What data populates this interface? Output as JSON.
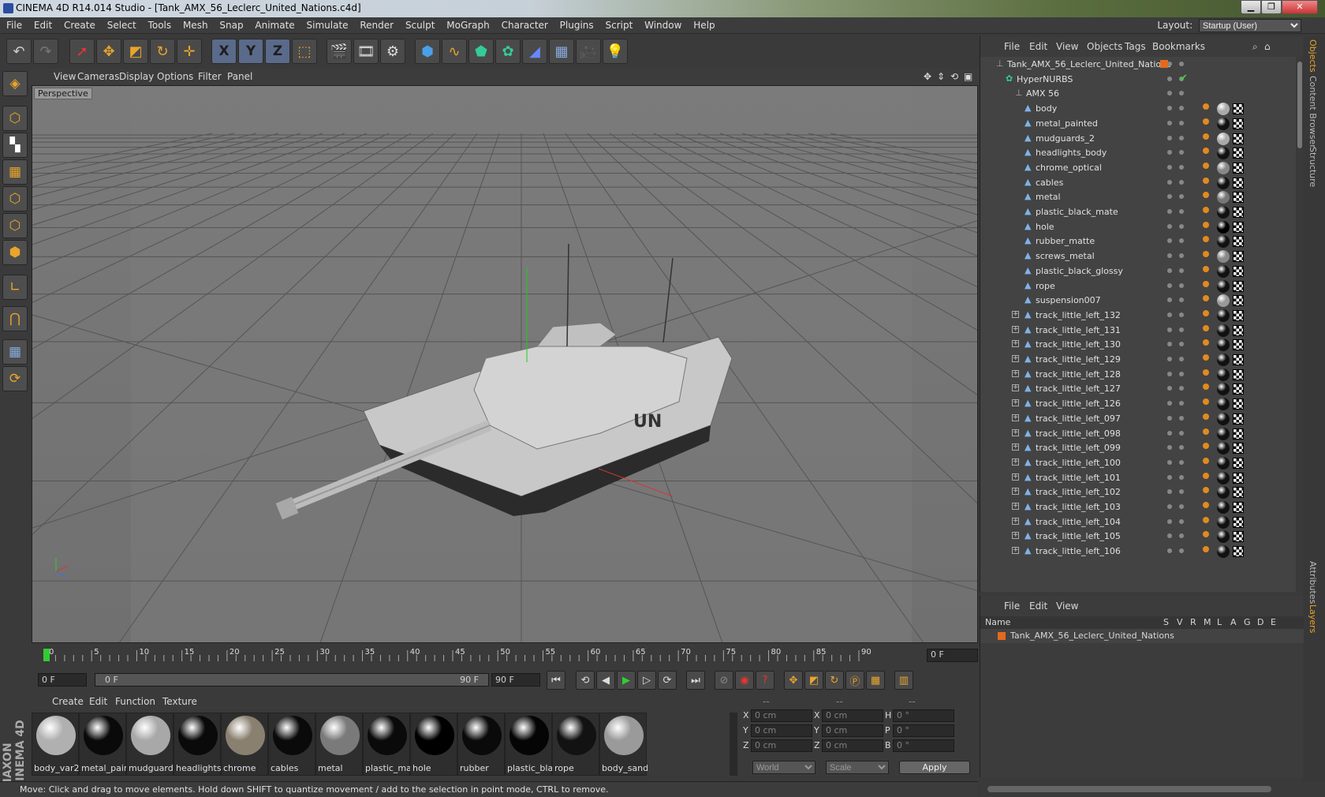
{
  "window": {
    "title": "CINEMA 4D R14.014 Studio - [Tank_AMX_56_Leclerc_United_Nations.c4d]",
    "min": "▁",
    "max": "❐",
    "close": "✕"
  },
  "menu": [
    "File",
    "Edit",
    "Create",
    "Select",
    "Tools",
    "Mesh",
    "Snap",
    "Animate",
    "Simulate",
    "Render",
    "Sculpt",
    "MoGraph",
    "Character",
    "Plugins",
    "Script",
    "Window",
    "Help"
  ],
  "layout": {
    "label": "Layout:",
    "value": "Startup (User)"
  },
  "toolbar": [
    "undo-icon",
    "redo-icon",
    "live-select-icon",
    "move-icon",
    "scale-icon",
    "rotate-icon",
    "add-icon",
    "x-axis",
    "y-axis",
    "z-axis",
    "coord-system-icon",
    "render-view-icon",
    "render-picture-viewer-icon",
    "render-settings-icon",
    "cube-icon",
    "spline-icon",
    "nurbs-icon",
    "array-icon",
    "deformer-icon",
    "floor-icon",
    "camera-icon",
    "light-icon"
  ],
  "toolbar_axes": {
    "x": "X",
    "y": "Y",
    "z": "Z"
  },
  "view_menu": [
    "View",
    "Cameras",
    "Display",
    "Options",
    "Filter",
    "Panel"
  ],
  "viewport": {
    "label": "Perspective",
    "tank_marking": "UN"
  },
  "timeline": {
    "ticks": [
      "0",
      "5",
      "10",
      "15",
      "20",
      "25",
      "30",
      "35",
      "40",
      "45",
      "50",
      "55",
      "60",
      "65",
      "70",
      "75",
      "80",
      "85",
      "90"
    ],
    "current": "0 F"
  },
  "playbar": {
    "start": "0 F",
    "range_start": "0 F",
    "range_end": "90 F",
    "end": "90 F"
  },
  "materials": {
    "menu": [
      "Create",
      "Edit",
      "Function",
      "Texture"
    ],
    "items": [
      {
        "name": "body_var2",
        "color": "#b0b0b0"
      },
      {
        "name": "metal_pain",
        "color": "#0a0a0a"
      },
      {
        "name": "mudguards",
        "color": "#a8a8a8"
      },
      {
        "name": "headlights_",
        "color": "#0a0a0a"
      },
      {
        "name": "chrome",
        "color": "#8a8070"
      },
      {
        "name": "cables",
        "color": "#0a0a0a"
      },
      {
        "name": "metal",
        "color": "#7a7a7a"
      },
      {
        "name": "plastic_mat",
        "color": "#0a0a0a"
      },
      {
        "name": "hole",
        "color": "#000000"
      },
      {
        "name": "rubber",
        "color": "#0a0a0a"
      },
      {
        "name": "plastic_bla",
        "color": "#050505"
      },
      {
        "name": "rope",
        "color": "#121212"
      },
      {
        "name": "body_sand",
        "color": "#9a9a9a"
      }
    ]
  },
  "coords": {
    "header": [
      "--",
      "--",
      "--"
    ],
    "rows": [
      {
        "a": "X",
        "av": "0 cm",
        "b": "X",
        "bv": "0 cm",
        "c": "H",
        "cv": "0 °"
      },
      {
        "a": "Y",
        "av": "0 cm",
        "b": "Y",
        "bv": "0 cm",
        "c": "P",
        "cv": "0 °"
      },
      {
        "a": "Z",
        "av": "0 cm",
        "b": "Z",
        "bv": "0 cm",
        "c": "B",
        "cv": "0 °"
      }
    ],
    "world": "World",
    "scale": "Scale",
    "apply": "Apply"
  },
  "status": "Move: Click and drag to move elements. Hold down SHIFT to quantize movement / add to the selection in point mode, CTRL to remove.",
  "objects": {
    "menu": [
      "File",
      "Edit",
      "View",
      "Objects",
      "Tags",
      "Bookmarks"
    ],
    "root": "Tank_AMX_56_Leclerc_United_Nations",
    "hypernurbs": "HyperNURBS",
    "group": "AMX 56",
    "items": [
      "body",
      "metal_painted",
      "mudguards_2",
      "headlights_body",
      "chrome_optical",
      "cables",
      "metal",
      "plastic_black_mate",
      "hole",
      "rubber_matte",
      "screws_metal",
      "plastic_black_glossy",
      "rope",
      "suspension007",
      "track_little_left_132",
      "track_little_left_131",
      "track_little_left_130",
      "track_little_left_129",
      "track_little_left_128",
      "track_little_left_127",
      "track_little_left_126",
      "track_little_left_097",
      "track_little_left_098",
      "track_little_left_099",
      "track_little_left_100",
      "track_little_left_101",
      "track_little_left_102",
      "track_little_left_103",
      "track_little_left_104",
      "track_little_left_105",
      "track_little_left_106"
    ]
  },
  "sidetabs": [
    "Objects",
    "Content Browser",
    "Structure",
    "Attributes",
    "Layers"
  ],
  "layers": {
    "menu": [
      "File",
      "Edit",
      "View"
    ],
    "cols": [
      "Name",
      "S",
      "V",
      "R",
      "M",
      "L",
      "A",
      "G",
      "D",
      "E"
    ],
    "row": "Tank_AMX_56_Leclerc_United_Nations"
  },
  "colors": {
    "accent": "#e9a52c",
    "orange_tag": "#e28a1e",
    "bg": "#3a3a3a"
  }
}
